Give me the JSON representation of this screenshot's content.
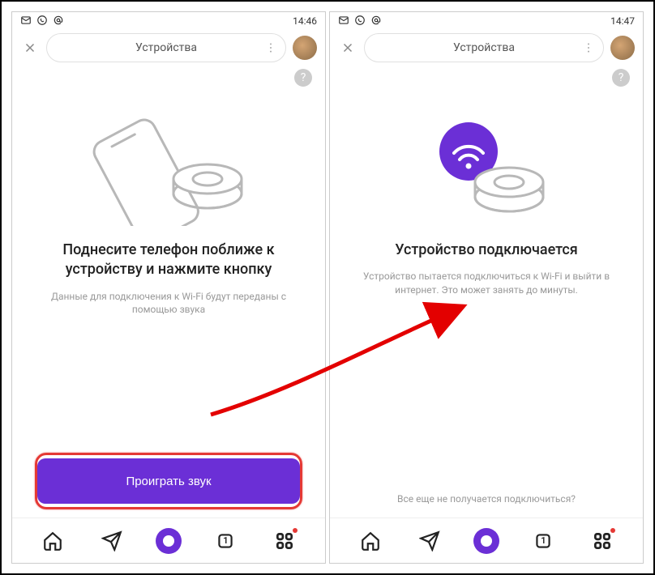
{
  "left": {
    "status_time": "14:46",
    "header_title": "Устройства",
    "help": "?",
    "title": "Поднесите телефон поближе к устройству и нажмите кнопку",
    "subtitle": "Данные для подключения к Wi-Fi будут переданы с помощью звука",
    "play_button": "Проиграть звук"
  },
  "right": {
    "status_time": "14:47",
    "header_title": "Устройства",
    "help": "?",
    "title": "Устройство подключается",
    "subtitle": "Устройство пытается подключиться к Wi-Fi и выйти в интернет. Это может занять до минуты.",
    "hint": "Все еще не получается подключиться?"
  },
  "nav": {
    "tabs_count": "1"
  }
}
